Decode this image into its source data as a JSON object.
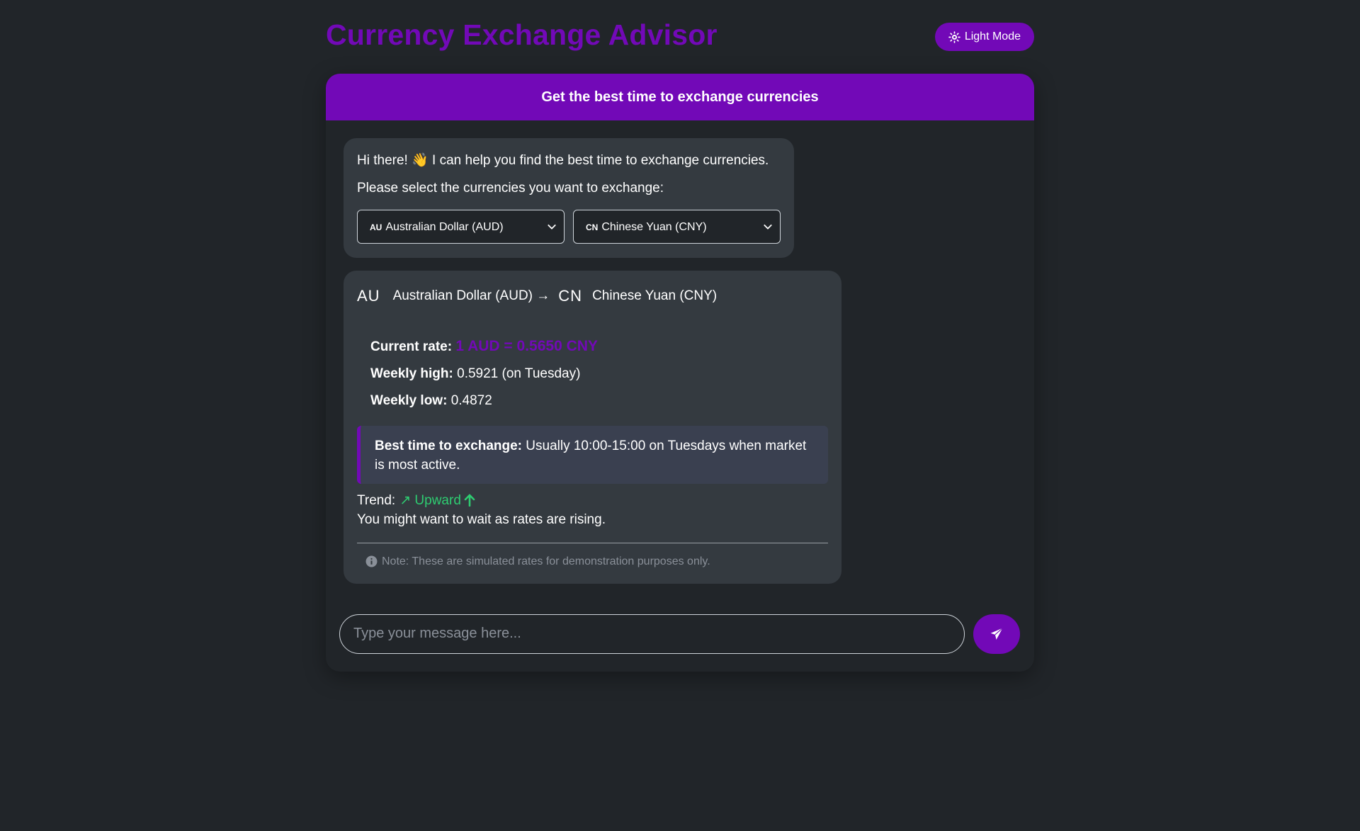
{
  "header": {
    "title": "Currency Exchange Advisor",
    "theme_toggle_label": "Light Mode",
    "theme_toggle_icon": "sun-icon"
  },
  "chat": {
    "banner": "Get the best time to exchange currencies",
    "greeting": {
      "line1_pre": "Hi there!",
      "wave_emoji": "👋",
      "line1_post": "I can help you find the best time to exchange currencies.",
      "line2": "Please select the currencies you want to exchange:"
    },
    "from_select": {
      "code": "AU",
      "label": "Australian Dollar (AUD)"
    },
    "to_select": {
      "code": "CN",
      "label": "Chinese Yuan (CNY)"
    },
    "result": {
      "from_code": "AU",
      "from_name": "Australian Dollar (AUD) →",
      "to_code": "CN",
      "to_name": "Chinese Yuan (CNY)",
      "current_rate_label": "Current rate:",
      "current_rate_value": "1 AUD = 0.5650 CNY",
      "weekly_high_label": "Weekly high:",
      "weekly_high_value": "0.5921 (on Tuesday)",
      "weekly_low_label": "Weekly low:",
      "weekly_low_value": "0.4872",
      "best_time_label": "Best time to exchange:",
      "best_time_value": "Usually 10:00-15:00 on Tuesdays when market is most active.",
      "trend_label": "Trend:",
      "trend_value": "↗ Upward",
      "advice": "You might want to wait as rates are rising.",
      "note": "Note: These are simulated rates for demonstration purposes only."
    }
  },
  "composer": {
    "placeholder": "Type your message here..."
  },
  "colors": {
    "accent": "#7209b7",
    "background": "#212529",
    "bubble": "#343a40",
    "trend_up": "#2ecc71"
  }
}
